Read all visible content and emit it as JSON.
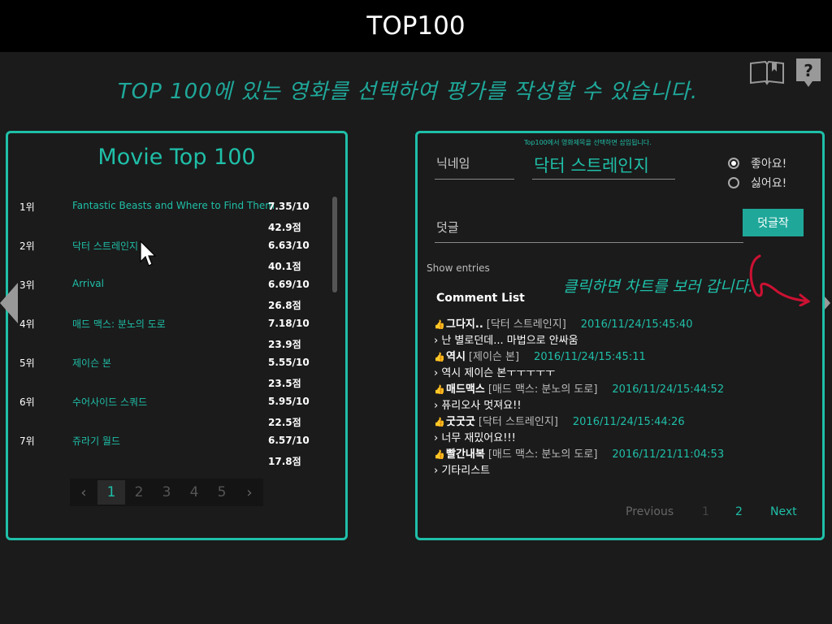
{
  "header": {
    "title": "TOP100"
  },
  "headline": "TOP 100에 있는 영화를 선택하여 평가를 작성할 수 있습니다.",
  "left_panel": {
    "title": "Movie Top 100",
    "movies": [
      {
        "rank": "1위",
        "title": "Fantastic Beasts and Where to Find Them",
        "rating": "7.35/10",
        "score": "42.9점"
      },
      {
        "rank": "2위",
        "title": "닥터 스트레인지",
        "rating": "6.63/10",
        "score": "40.1점"
      },
      {
        "rank": "3위",
        "title": "Arrival",
        "rating": "6.69/10",
        "score": "26.8점"
      },
      {
        "rank": "4위",
        "title": "매드 맥스: 분노의 도로",
        "rating": "7.18/10",
        "score": "23.9점"
      },
      {
        "rank": "5위",
        "title": "제이슨 본",
        "rating": "5.55/10",
        "score": "23.5점"
      },
      {
        "rank": "6위",
        "title": "수어사이드 스쿼드",
        "rating": "5.95/10",
        "score": "22.5점"
      },
      {
        "rank": "7위",
        "title": "쥬라기 월드",
        "rating": "6.57/10",
        "score": "17.8점"
      }
    ],
    "pagination": {
      "prev": "‹",
      "next": "›",
      "pages": [
        "1",
        "2",
        "3",
        "4",
        "5"
      ],
      "current": "1"
    }
  },
  "form": {
    "hint": "Top100에서 영화제목을 선택하면 삽입됩니다.",
    "nickname_label": "닉네임",
    "movie_value": "닥터 스트레인지",
    "like_label": "좋아요!",
    "dislike_label": "싫어요!",
    "comment_label": "덧글",
    "submit_label": "덧글작"
  },
  "comments_section": {
    "show_entries": "Show entries",
    "annotation": "클릭하면 차트를 보러 갑니다.",
    "title": "Comment List",
    "items": [
      {
        "author": "그다지..",
        "movie": "[닥터 스트레인지]",
        "date": "2016/11/24/15:45:40",
        "text": "› 난 별로던데... 마법으로 안싸움"
      },
      {
        "author": "역시",
        "movie": "[제이슨 본]",
        "date": "2016/11/24/15:45:11",
        "text": "› 역시 제이슨 본ㅜㅜㅜㅜㅜ"
      },
      {
        "author": "매드맥스",
        "movie": "[매드 맥스: 분노의 도로]",
        "date": "2016/11/24/15:44:52",
        "text": "› 퓨리오사 멋져요!!"
      },
      {
        "author": "굿굿굿",
        "movie": "[닥터 스트레인지]",
        "date": "2016/11/24/15:44:26",
        "text": "› 너무 재밌어요!!!"
      },
      {
        "author": "빨간내복",
        "movie": "[매드 맥스: 분노의 도로]",
        "date": "2016/11/21/11:04:53",
        "text": "› 기타리스트"
      }
    ],
    "pagination": {
      "previous": "Previous",
      "page1": "1",
      "page2": "2",
      "next": "Next"
    }
  },
  "colors": {
    "accent": "#1fbfa8",
    "background": "#1b1b1b",
    "topbar": "#000000",
    "annotation_arrow": "#cc1133"
  },
  "icons": [
    "book-icon",
    "help-icon",
    "left-arrow-icon",
    "right-arrow-icon",
    "thumbs-up-icon",
    "mouse-cursor-icon"
  ]
}
